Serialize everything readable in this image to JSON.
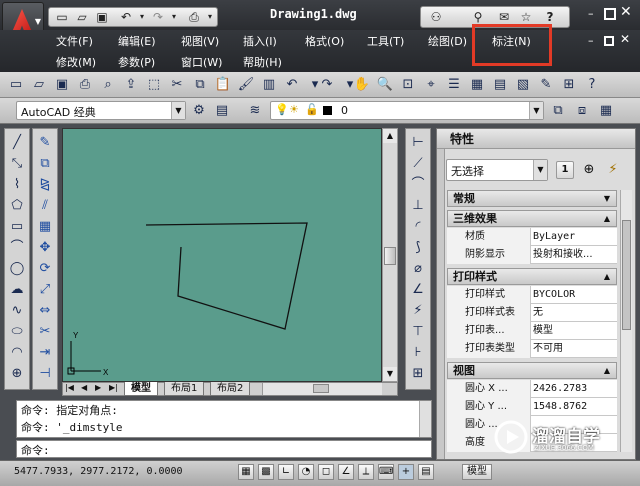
{
  "title": "Drawing1.dwg",
  "menu_row1": [
    "文件(F)",
    "编辑(E)",
    "视图(V)",
    "插入(I)",
    "格式(O)",
    "工具(T)",
    "绘图(D)",
    "标注(N)"
  ],
  "menu_row2": [
    "修改(M)",
    "参数(P)",
    "窗口(W)",
    "帮助(H)"
  ],
  "highlight_color": "#e23a26",
  "workspace": "AutoCAD 经典",
  "layer": "0",
  "layout_tabs": [
    "模型",
    "布局1",
    "布局2"
  ],
  "commands": [
    "命令: 指定对角点:",
    "命令: '_dimstyle"
  ],
  "command_prompt": "命令:",
  "coords": "5477.7933, 2977.2172, 0.0000",
  "status_model": "模型",
  "properties": {
    "title": "特性",
    "selection": "无选择",
    "sections": {
      "general": "常规",
      "three_d": "三维效果",
      "plot": "打印样式",
      "view": "视图"
    },
    "three_d_rows": [
      {
        "key": "材质",
        "value": "ByLayer"
      },
      {
        "key": "阴影显示",
        "value": "投射和接收..."
      }
    ],
    "plot_rows": [
      {
        "key": "打印样式",
        "value": "BYCOLOR"
      },
      {
        "key": "打印样式表",
        "value": "无"
      },
      {
        "key": "打印表...",
        "value": "模型"
      },
      {
        "key": "打印表类型",
        "value": "不可用"
      }
    ],
    "view_rows": [
      {
        "key": "圆心 X ...",
        "value": "2426.2783"
      },
      {
        "key": "圆心 Y ...",
        "value": "1548.8762"
      },
      {
        "key": "圆心 ...",
        "value": ""
      },
      {
        "key": "高度",
        "value": ""
      }
    ]
  },
  "watermark": {
    "brand": "溜溜自学",
    "url": "ZIXUE.3066.COM"
  }
}
